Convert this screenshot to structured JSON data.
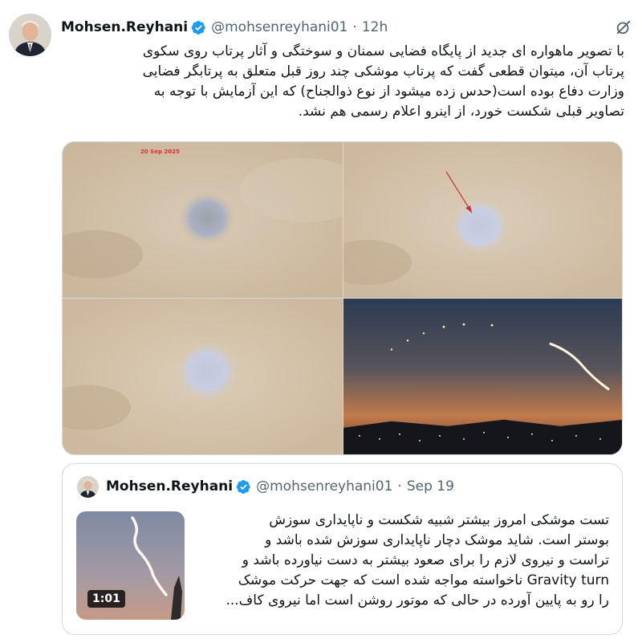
{
  "tweet": {
    "display_name": "Mohsen.Reyhani",
    "handle": "@mohsenreyhani01",
    "separator": "·",
    "time": "12h",
    "text": "با تصویر ماهواره ای جدید از پایگاه فضایی سمنان و سوختگی و آثار پرتاب روی سکوی\nپرتاب آن، میتوان قطعی گفت که پرتاب موشکی چند روز قبل متعلق به پرتابگر فضایی\nوزارت دفاع بوده است(حدس زده میشود از نوع ذوالجناح) که این آزمایش با توجه به\nتصاویر قبلی شکست خورد، از اینرو اعلام رسمی هم نشد."
  },
  "media": {
    "image_1_date": "20 Sep 2025"
  },
  "quote": {
    "display_name": "Mohsen.Reyhani",
    "handle": "@mohsenreyhani01",
    "separator": "·",
    "time": "Sep 19",
    "video_duration": "1:01",
    "text": "تست موشکی امروز بیشتر شبیه شکست و ناپایداری سوزش\nبوستر است. شاید موشک دچار ناپایداری سوزش شده باشد و\nتراست و نیروی لازم را برای صعود بیشتر به دست نیاورده باشد و\nGravity turn ناخواسته مواجه شده است که جهت حرکت موشک\nرا رو به پایین آورده در حالی که موتور روشن است اما نیروی کاف..."
  },
  "colors": {
    "verified": "#1d9bf0",
    "secondary_text": "#536471",
    "border": "#cfd9de"
  },
  "icons": [
    "verified-badge-icon",
    "grok-icon"
  ]
}
